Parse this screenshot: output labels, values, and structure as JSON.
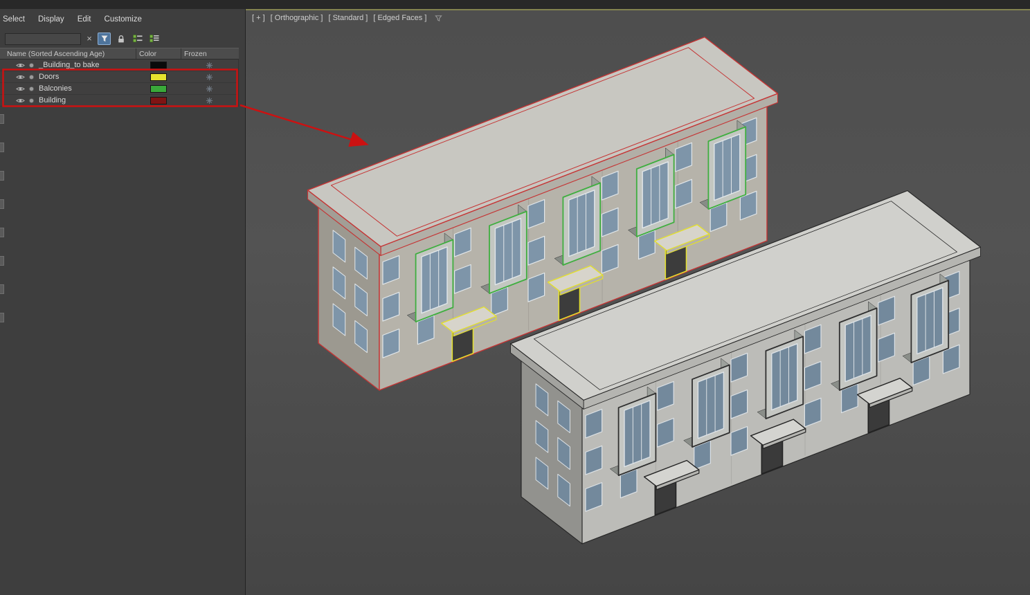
{
  "explorer": {
    "menu": [
      "Select",
      "Display",
      "Edit",
      "Customize"
    ],
    "toolbar": {
      "search_value": "",
      "clear_label": "×",
      "icons": [
        "clear-icon",
        "filter-icon",
        "lock-icon",
        "list-icon",
        "list-alt-icon"
      ],
      "filter_active_color": "#4e749c"
    },
    "columns": [
      "Name (Sorted Ascending Age)",
      "Color",
      "Frozen"
    ],
    "row_icons": [
      "eye-icon",
      "dot-icon",
      "snowflake-icon"
    ],
    "rows": [
      {
        "name": "_Building_to bake",
        "color": "#0a0a0a",
        "frozen": true
      },
      {
        "name": "Doors",
        "color": "#e6e22e",
        "frozen": true
      },
      {
        "name": "Balconies",
        "color": "#3aa93a",
        "frozen": true
      },
      {
        "name": "Building",
        "color": "#7e1414",
        "frozen": true
      }
    ]
  },
  "viewport": {
    "label_segments": [
      "[ + ]",
      "[ Orthographic ]",
      "[ Standard ]",
      "[ Edged Faces ]"
    ],
    "label_icon": "filter-icon",
    "scene": {
      "selected_building": {
        "edge_color": "#c53434",
        "balcony_color": "#3fae3f",
        "door_color": "#e3df2e"
      },
      "unselected_building": {
        "edge_color": "#242424"
      }
    }
  },
  "annotation": {
    "highlight_color": "#cc1111"
  }
}
